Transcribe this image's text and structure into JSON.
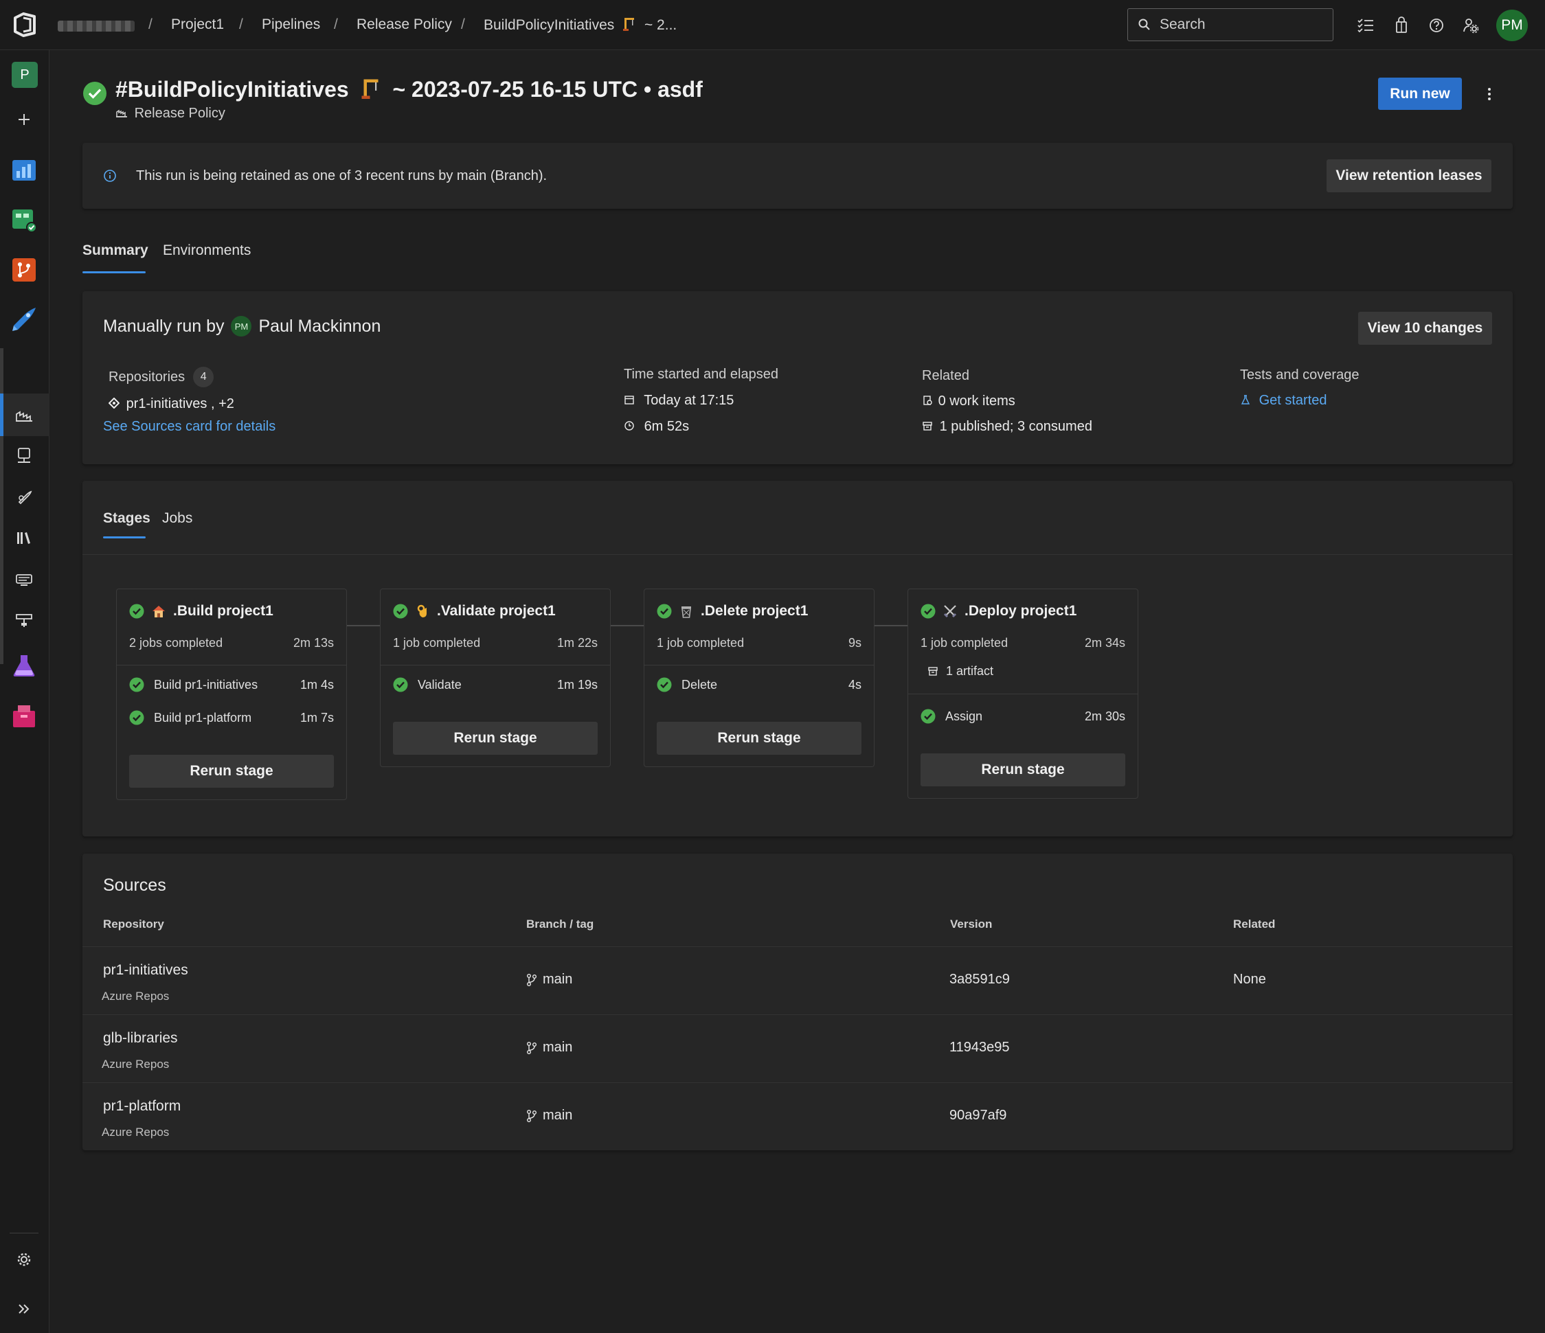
{
  "breadcrumb": {
    "project": "Project1",
    "pipelines": "Pipelines",
    "folder": "Release Policy",
    "run": "BuildPolicyInitiatives",
    "run_suffix": "~ 2..."
  },
  "search": {
    "placeholder": "Search"
  },
  "user": {
    "initials": "PM"
  },
  "nav": {
    "project_initial": "P"
  },
  "run": {
    "title": "#BuildPolicyInitiatives",
    "title_suffix": "~ 2023-07-25 16-15 UTC • asdf",
    "pipeline": "Release Policy",
    "run_new_label": "Run new"
  },
  "banner": {
    "message": "This run is being retained as one of 3 recent runs by main (Branch).",
    "button_label": "View retention leases"
  },
  "tabs": [
    "Summary",
    "Environments"
  ],
  "summary": {
    "manually_run_by": "Manually run by",
    "user_initials": "PM",
    "user_name": "Paul Mackinnon",
    "view_changes_label": "View 10 changes",
    "repositories_label": "Repositories",
    "repositories_count": "4",
    "repo_primary": "pr1-initiatives",
    "repo_more": ", +2",
    "sources_link": "See Sources card for details",
    "time_label": "Time started and elapsed",
    "started": "Today at 17:15",
    "elapsed": "6m 52s",
    "related_label": "Related",
    "work_items": "0 work items",
    "artifacts": "1 published; 3 consumed",
    "tests_label": "Tests and coverage",
    "tests_link": "Get started"
  },
  "stage_tabs": [
    "Stages",
    "Jobs"
  ],
  "stages": [
    {
      "name": ".Build project1",
      "summary": "2 jobs completed",
      "duration": "2m 13s",
      "jobs": [
        {
          "name": "Build pr1-initiatives",
          "duration": "1m 4s"
        },
        {
          "name": "Build pr1-platform",
          "duration": "1m 7s"
        }
      ],
      "rerun": "Rerun stage"
    },
    {
      "name": ".Validate project1",
      "summary": "1 job completed",
      "duration": "1m 22s",
      "jobs": [
        {
          "name": "Validate",
          "duration": "1m 19s"
        }
      ],
      "rerun": "Rerun stage"
    },
    {
      "name": ".Delete project1",
      "summary": "1 job completed",
      "duration": "9s",
      "jobs": [
        {
          "name": "Delete",
          "duration": "4s"
        }
      ],
      "rerun": "Rerun stage"
    },
    {
      "name": ".Deploy project1",
      "summary": "1 job completed",
      "duration": "2m 34s",
      "artifact": "1 artifact",
      "jobs": [
        {
          "name": "Assign",
          "duration": "2m 30s"
        }
      ],
      "rerun": "Rerun stage"
    }
  ],
  "sources": {
    "title": "Sources",
    "columns": [
      "Repository",
      "Branch / tag",
      "Version",
      "Related"
    ],
    "rows": [
      {
        "repo": "pr1-initiatives",
        "provider": "Azure Repos",
        "branch": "main",
        "version": "3a8591c9",
        "related": "None"
      },
      {
        "repo": "glb-libraries",
        "provider": "Azure Repos",
        "branch": "main",
        "version": "11943e95",
        "related": ""
      },
      {
        "repo": "pr1-platform",
        "provider": "Azure Repos",
        "branch": "main",
        "version": "90a97af9",
        "related": ""
      }
    ]
  },
  "colors": {
    "accent": "#2a6fc9",
    "success": "#4caf50",
    "link": "#5aa9f2",
    "background": "#1f1f1f",
    "card": "#262626"
  }
}
